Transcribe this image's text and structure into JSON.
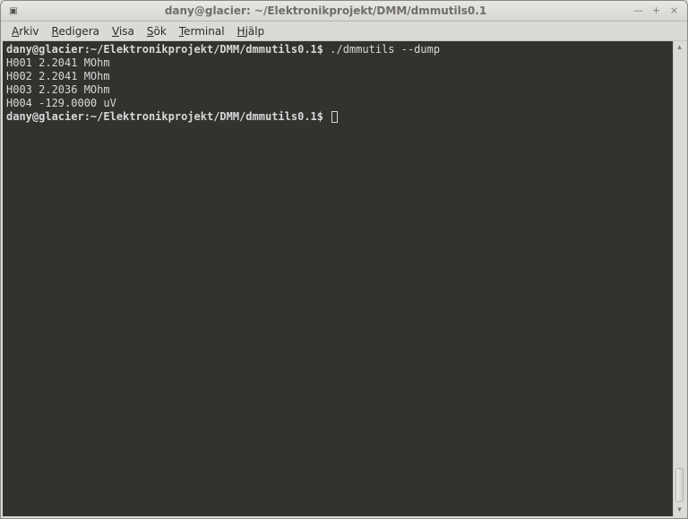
{
  "window": {
    "title": "dany@glacier: ~/Elektronikprojekt/DMM/dmmutils0.1"
  },
  "titlebar_buttons": {
    "minimize": "—",
    "maximize": "+",
    "close": "×"
  },
  "menubar": {
    "arkiv": {
      "u": "A",
      "rest": "rkiv"
    },
    "redigera": {
      "u": "R",
      "rest": "edigera"
    },
    "visa": {
      "u": "V",
      "rest": "isa"
    },
    "sok": {
      "u": "S",
      "rest": "ök"
    },
    "terminal": {
      "u": "T",
      "rest": "erminal"
    },
    "hjalp": {
      "u": "H",
      "rest": "jälp"
    }
  },
  "terminal": {
    "prompt": "dany@glacier:~/Elektronikprojekt/DMM/dmmutils0.1$",
    "command": "./dmmutils --dump",
    "lines": {
      "l0": "H001 2.2041 MOhm",
      "l1": "H002 2.2041 MOhm",
      "l2": "H003 2.2036 MOhm",
      "l3": "H004 -129.0000 uV"
    }
  },
  "icons": {
    "app": "▣",
    "up": "▴",
    "down": "▾"
  }
}
